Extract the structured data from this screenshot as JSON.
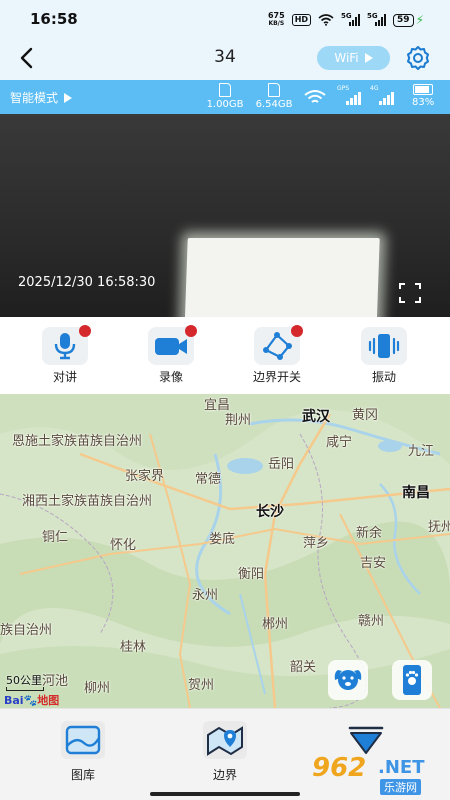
{
  "status_bar": {
    "time": "16:58",
    "net_speed_value": "675",
    "net_speed_unit": "KB/S",
    "hd_badge": "HD",
    "signal1_gen": "5G",
    "signal2_gen": "5G",
    "battery": "59"
  },
  "header": {
    "title": "34",
    "wifi_button": "WiFi"
  },
  "info_bar": {
    "mode": "智能模式",
    "storage1": "1.00GB",
    "storage2": "6.54GB",
    "gps_tag": "GPS",
    "lte_tag": "4G",
    "battery": "83%"
  },
  "video": {
    "timestamp": "2025/12/30 16:58:30"
  },
  "actions": [
    {
      "label": "对讲",
      "icon": "microphone-icon",
      "badge": true
    },
    {
      "label": "录像",
      "icon": "video-camera-icon",
      "badge": true
    },
    {
      "label": "边界开关",
      "icon": "fence-boundary-icon",
      "badge": true
    },
    {
      "label": "振动",
      "icon": "vibrate-icon",
      "badge": false
    }
  ],
  "map": {
    "cities": [
      "宜昌",
      "荆州",
      "武汉",
      "黄冈",
      "恩施土家族苗族自治州",
      "咸宁",
      "九江",
      "岳阳",
      "张家界",
      "常德",
      "南昌",
      "湘西土家族苗族自治州",
      "长沙",
      "铜仁",
      "怀化",
      "娄底",
      "新余",
      "萍乡",
      "抚州",
      "吉安",
      "衡阳",
      "永州",
      "郴州",
      "赣州",
      "族自治州",
      "桂林",
      "韶关",
      "河池",
      "柳州",
      "贺州"
    ],
    "scale": "50公里",
    "logo_left": "Bai",
    "logo_right": "地图",
    "colors": {
      "land": "#d6e5c7",
      "water": "#a9d3ea",
      "road": "#f5c98b"
    }
  },
  "bottom_tabs": [
    {
      "label": "图库",
      "icon": "gallery-icon"
    },
    {
      "label": "边界",
      "icon": "map-boundary-icon"
    },
    {
      "label": "",
      "icon": "collapse-down-icon"
    }
  ],
  "watermark": {
    "number": "962",
    "suffix": ".NET",
    "cn": "乐游网"
  }
}
